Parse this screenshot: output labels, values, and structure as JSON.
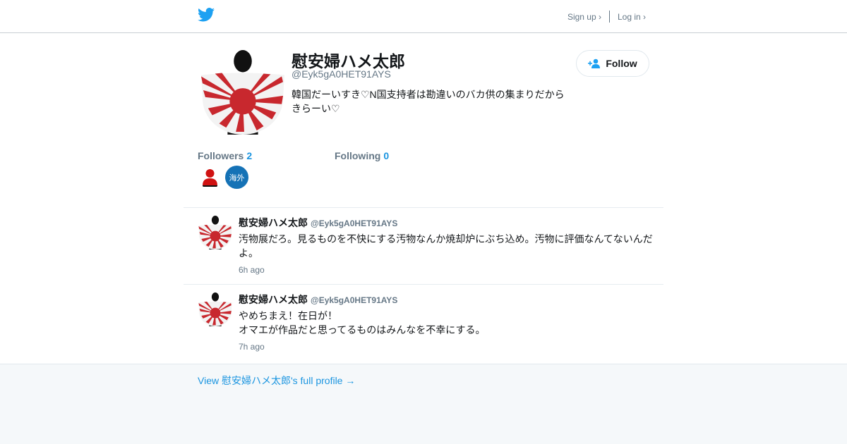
{
  "header": {
    "logo_icon": "twitter-bird-icon",
    "signup_label": "Sign up ›",
    "login_label": "Log in ›"
  },
  "profile": {
    "name": "慰安婦ハメ太郎",
    "handle": "@Eyk5gA0HET91AYS",
    "bio": "韓国だーいすき♡N国支持者は勘違いのバカ供の集まりだから\nきらーい♡",
    "follow_label": "Follow",
    "followers_label": "Followers",
    "followers_count": "2",
    "following_label": "Following",
    "following_count": "0",
    "follower_badge_text": "海外"
  },
  "tweets": [
    {
      "name": "慰安婦ハメ太郎",
      "handle": "@Eyk5gA0HET91AYS",
      "text": "汚物展だろ。見るものを不快にする汚物なんか焼却炉にぶち込め。汚物に評価なんてないんだよ。",
      "time": "6h ago"
    },
    {
      "name": "慰安婦ハメ太郎",
      "handle": "@Eyk5gA0HET91AYS",
      "text": "やめちまえ！在日が！\nオマエが作品だと思ってるものはみんなを不幸にする。",
      "time": "7h ago"
    }
  ],
  "footer": {
    "profile_link": "View 慰安婦ハメ太郎's full profile →"
  },
  "colors": {
    "twitter_blue": "#1da1f2",
    "link_blue": "#1b95e0",
    "flag_red": "#c8282e"
  }
}
